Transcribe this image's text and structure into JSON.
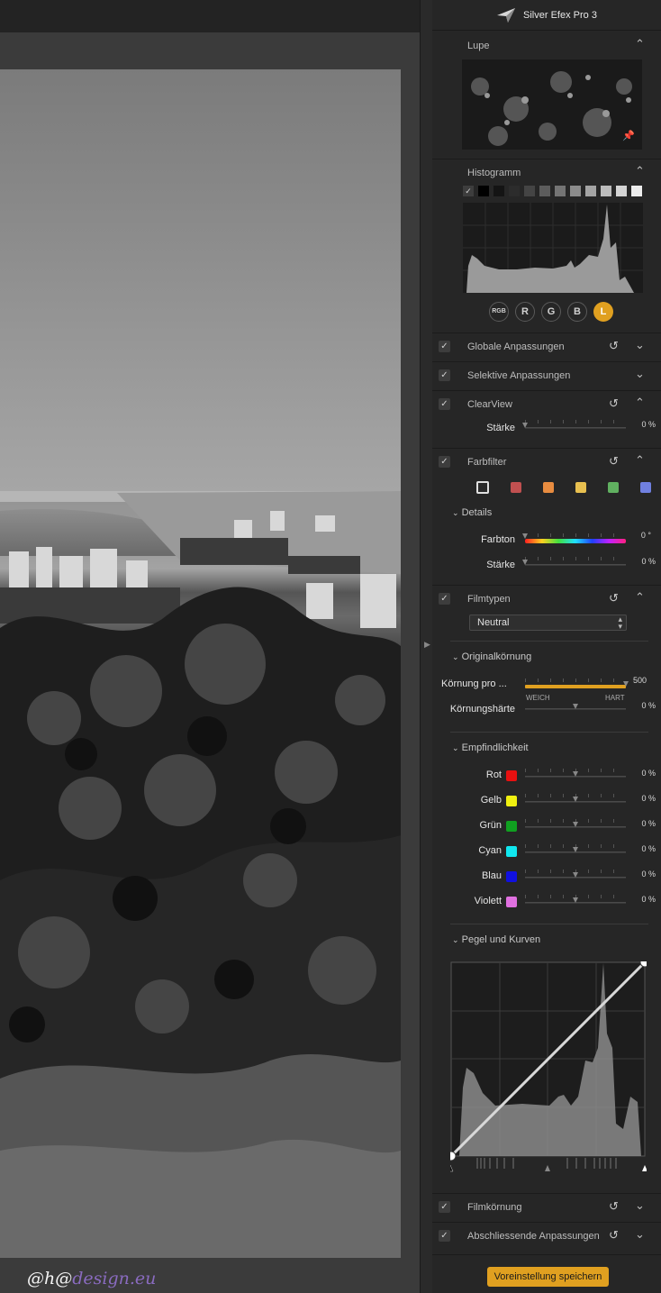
{
  "app": {
    "title": "Silver Efex Pro 3"
  },
  "watermark": {
    "prefix": "@h@",
    "suffix": "design.eu"
  },
  "lupe": {
    "label": "Lupe"
  },
  "histogram": {
    "label": "Histogramm",
    "channels": [
      "RGB",
      "R",
      "G",
      "B",
      "L"
    ],
    "active_channel": "L"
  },
  "sections": {
    "global": "Globale Anpassungen",
    "selective": "Selektive Anpassungen",
    "clearview": "ClearView",
    "farbfilter": "Farbfilter",
    "filmtypen": "Filmtypen",
    "filmkoernung": "Filmkörnung",
    "abschliessend": "Abschliessende Anpassungen"
  },
  "clearview": {
    "staerke_label": "Stärke",
    "staerke_value": "0 %",
    "staerke_level": 0
  },
  "farbfilter": {
    "swatches": [
      "#b0b0b0",
      "#c05050",
      "#e88c40",
      "#e8c050",
      "#60b060",
      "#7080e0"
    ],
    "details_label": "Details",
    "farbton_label": "Farbton",
    "farbton_value": "0 °",
    "staerke_label": "Stärke",
    "staerke_value": "0 %"
  },
  "filmtypen": {
    "selected": "Neutral",
    "original_label": "Originalkörnung",
    "koernung_label": "Körnung pro ...",
    "koernung_value": "500",
    "koernung_level": 1.0,
    "weich": "WEICH",
    "hart": "HART",
    "haerte_label": "Körnungshärte",
    "haerte_value": "0 %"
  },
  "empfindlichkeit": {
    "label": "Empfindlichkeit",
    "rows": [
      {
        "name": "Rot",
        "color": "#e81010",
        "value": "0 %"
      },
      {
        "name": "Gelb",
        "color": "#f0f010",
        "value": "0 %"
      },
      {
        "name": "Grün",
        "color": "#10a020",
        "value": "0 %"
      },
      {
        "name": "Cyan",
        "color": "#10e8f0",
        "value": "0 %"
      },
      {
        "name": "Blau",
        "color": "#1010e0",
        "value": "0 %"
      },
      {
        "name": "Violett",
        "color": "#e070e0",
        "value": "0 %"
      }
    ]
  },
  "kurven": {
    "label": "Pegel und Kurven"
  },
  "footer": {
    "save_label": "Voreinstellung speichern"
  },
  "colors": {
    "accent": "#e0a020"
  }
}
